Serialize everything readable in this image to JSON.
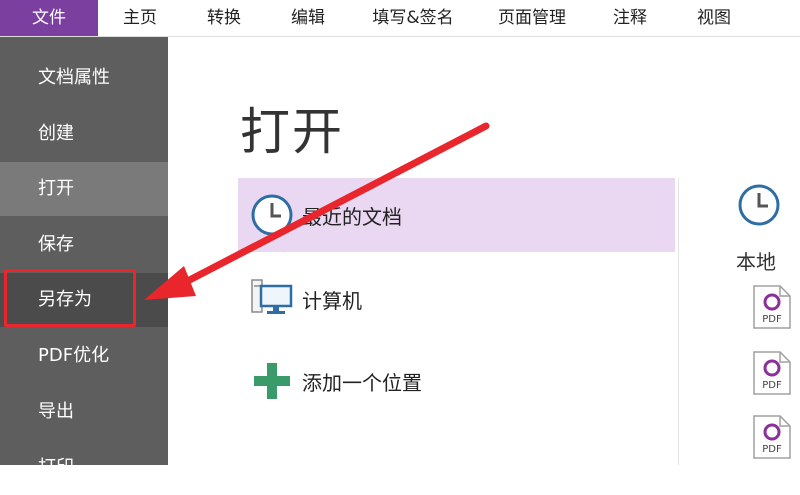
{
  "menubar": {
    "items": [
      {
        "label": "文件",
        "active": true
      },
      {
        "label": "主页"
      },
      {
        "label": "转换"
      },
      {
        "label": "编辑"
      },
      {
        "label": "填写&签名"
      },
      {
        "label": "页面管理"
      },
      {
        "label": "注释"
      },
      {
        "label": "视图"
      }
    ]
  },
  "sidebar": {
    "items": [
      {
        "label": "文档属性"
      },
      {
        "label": "创建"
      },
      {
        "label": "打开",
        "selected": true
      },
      {
        "label": "保存"
      },
      {
        "label": "另存为",
        "highlighted": true
      },
      {
        "label": "PDF优化"
      },
      {
        "label": "导出"
      },
      {
        "label": "打印"
      }
    ]
  },
  "main": {
    "title": "打开",
    "places": [
      {
        "label": "最近的文档",
        "icon": "clock-icon",
        "active": true
      },
      {
        "label": "计算机",
        "icon": "computer-icon"
      },
      {
        "label": "添加一个位置",
        "icon": "plus-icon"
      }
    ],
    "recent": {
      "local_label": "本地",
      "file_icon_text": "PDF"
    }
  },
  "colors": {
    "accent": "#7b3fa0",
    "sidebar": "#5e5e5e",
    "selected_place": "#ead8f2",
    "annotation": "#e8262b",
    "icon_blue": "#2f6ea5",
    "plus_green": "#3a9a6a"
  }
}
